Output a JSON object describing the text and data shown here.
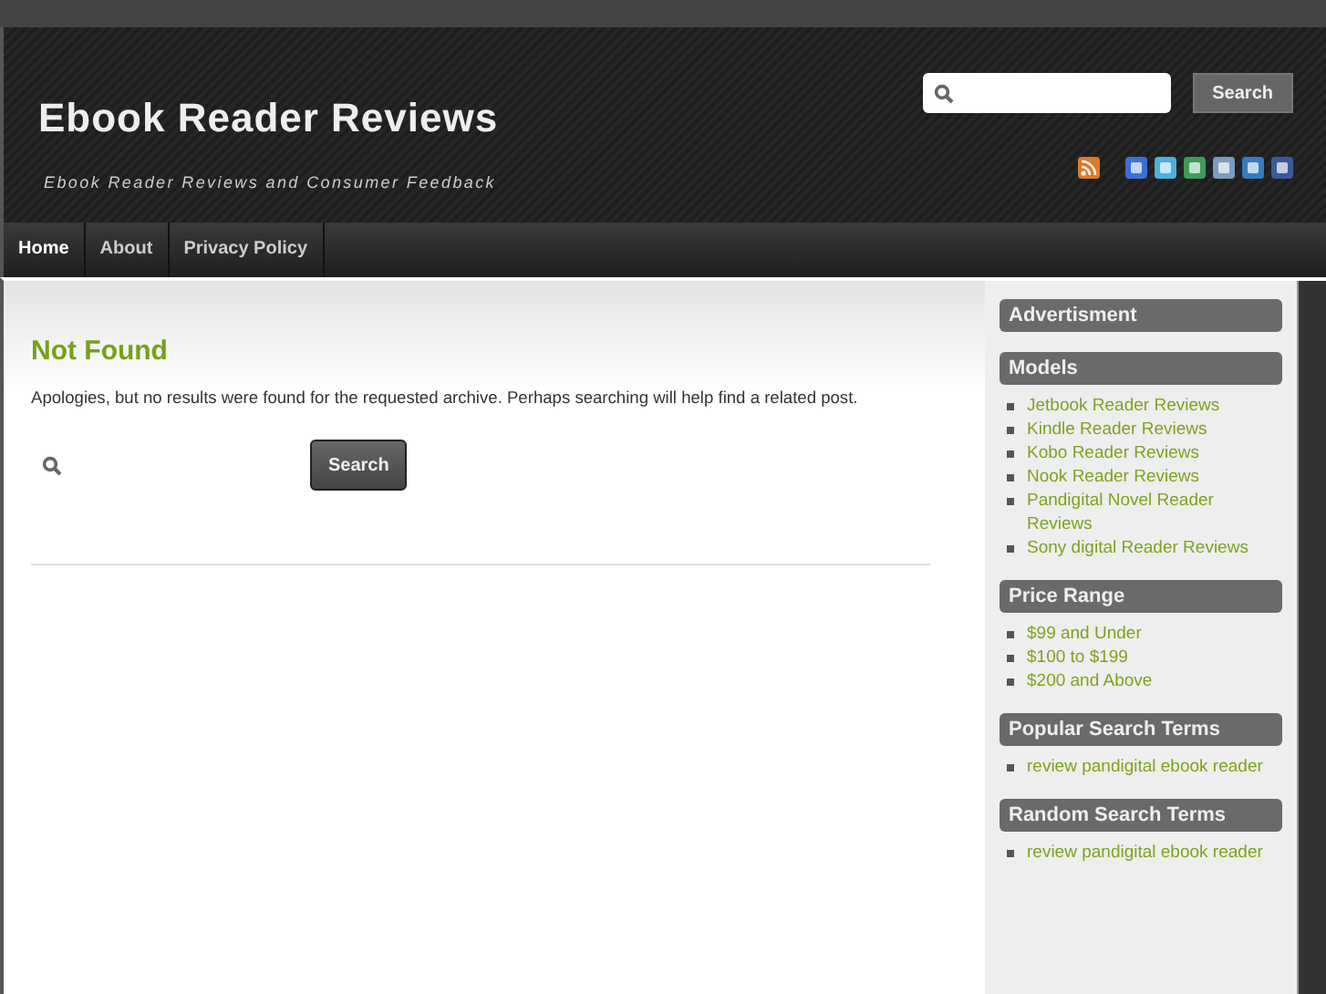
{
  "header": {
    "site_title": "Ebook Reader Reviews",
    "tagline": "Ebook Reader Reviews and Consumer Feedback",
    "search_button": "Search"
  },
  "nav": [
    {
      "label": "Home",
      "selected": true
    },
    {
      "label": "About",
      "selected": false
    },
    {
      "label": "Privacy Policy",
      "selected": false
    }
  ],
  "main": {
    "heading": "Not Found",
    "message": "Apologies, but no results were found for the requested archive. Perhaps searching will help find a related post.",
    "search_button": "Search"
  },
  "sidebar": [
    {
      "title": "Advertisment"
    },
    {
      "title": "Models",
      "links": [
        "Jetbook Reader Reviews",
        "Kindle Reader Reviews",
        "Kobo Reader Reviews",
        "Nook Reader Reviews",
        "Pandigital Novel Reader Reviews",
        "Sony digital Reader Reviews"
      ]
    },
    {
      "title": "Price Range",
      "links": [
        "$99 and Under",
        "$100 to $199",
        "$200 and Above"
      ]
    },
    {
      "title": "Popular Search Terms",
      "links": [
        "review pandigital ebook reader"
      ]
    },
    {
      "title": "Random Search Terms",
      "links": [
        "review pandigital ebook reader"
      ]
    }
  ]
}
